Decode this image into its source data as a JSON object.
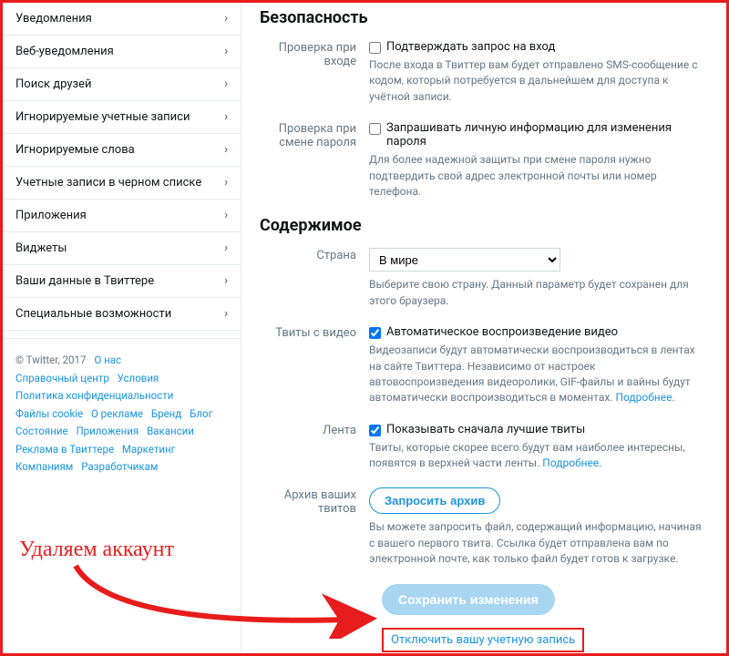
{
  "sidebar": {
    "items": [
      {
        "label": "Уведомления"
      },
      {
        "label": "Веб-уведомления"
      },
      {
        "label": "Поиск друзей"
      },
      {
        "label": "Игнорируемые учетные записи"
      },
      {
        "label": "Игнорируемые слова"
      },
      {
        "label": "Учетные записи в черном списке"
      },
      {
        "label": "Приложения"
      },
      {
        "label": "Виджеты"
      },
      {
        "label": "Ваши данные в Твиттере"
      },
      {
        "label": "Специальные возможности"
      }
    ]
  },
  "footer": {
    "links": [
      "© Twitter, 2017",
      "О нас",
      "Справочный центр",
      "Условия",
      "Политика конфиденциальности",
      "Файлы cookie",
      "О рекламе",
      "Бренд",
      "Блог",
      "Состояние",
      "Приложения",
      "Вакансии",
      "Реклама в Твиттере",
      "Маркетинг",
      "Компаниям",
      "Разработчикам"
    ]
  },
  "security": {
    "title": "Безопасность",
    "login_verify": {
      "label": "Проверка при входе",
      "checkbox_label": "Подтверждать запрос на вход",
      "help": "После входа в Твиттер вам будет отправлено SMS-сообщение с кодом, который потребуется в дальнейшем для доступа к учётной записи."
    },
    "password_change": {
      "label": "Проверка при смене пароля",
      "checkbox_label": "Запрашивать личную информацию для изменения пароля",
      "help": "Для более надежной защиты при смене пароля нужно подтвердить свой адрес электронной почты или номер телефона."
    }
  },
  "content": {
    "title": "Содержимое",
    "country": {
      "label": "Страна",
      "value": "В мире",
      "help": "Выберите свою страну. Данный параметр будет сохранен для этого браузера."
    },
    "video": {
      "label": "Твиты с видео",
      "checkbox_label": "Автоматическое воспроизведение видео",
      "help": "Видеозаписи будут автоматически воспроизводиться в лентах на сайте Твиттера. Независимо от настроек автовоспроизведения видеоролики, GIF-файлы и вайны будут автоматически воспроизводиться в моментах. ",
      "more": "Подробнее."
    },
    "timeline": {
      "label": "Лента",
      "checkbox_label": "Показывать сначала лучшие твиты",
      "help": "Твиты, которые скорее всего будут вам наиболее интересны, появятся в верхней части ленты. ",
      "more": "Подробнее."
    },
    "archive": {
      "label": "Архив ваших твитов",
      "button": "Запросить архив",
      "help": "Вы можете запросить файл, содержащий информацию, начиная с вашего первого твита. Ссылка будет отправлена вам по электронной почте, как только файл будет готов к загрузке."
    },
    "save_button": "Сохранить изменения",
    "deactivate": "Отключить вашу учетную запись"
  },
  "annotation": {
    "text": "Удаляем аккаунт"
  }
}
